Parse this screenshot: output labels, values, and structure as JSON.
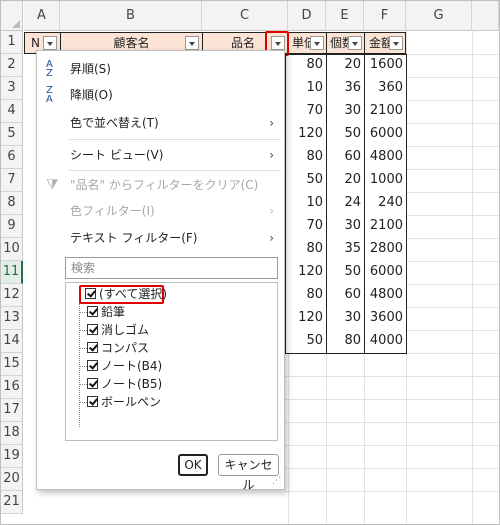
{
  "columns": [
    "A",
    "B",
    "C",
    "D",
    "E",
    "F",
    "G"
  ],
  "rows": [
    "1",
    "2",
    "3",
    "4",
    "5",
    "6",
    "7",
    "8",
    "9",
    "10",
    "11",
    "12",
    "13",
    "14",
    "15",
    "16",
    "17",
    "18",
    "19",
    "20",
    "21"
  ],
  "header_cells": {
    "a": "N",
    "b": "顧客名",
    "c": "品名",
    "d": "単価",
    "e": "個数",
    "f": "金額"
  },
  "data_rows": [
    [
      "80",
      "20",
      "1600"
    ],
    [
      "10",
      "36",
      "360"
    ],
    [
      "70",
      "30",
      "2100"
    ],
    [
      "120",
      "50",
      "6000"
    ],
    [
      "80",
      "60",
      "4800"
    ],
    [
      "50",
      "20",
      "1000"
    ],
    [
      "10",
      "24",
      "240"
    ],
    [
      "70",
      "30",
      "2100"
    ],
    [
      "80",
      "35",
      "2800"
    ],
    [
      "120",
      "50",
      "6000"
    ],
    [
      "80",
      "60",
      "4800"
    ],
    [
      "120",
      "30",
      "3600"
    ],
    [
      "50",
      "80",
      "4000"
    ]
  ],
  "menu": {
    "sort_asc": "昇順(S)",
    "sort_desc": "降順(O)",
    "sort_by_color": "色で並べ替え(T)",
    "sheet_view": "シート ビュー(V)",
    "clear_filter": "\"品名\" からフィルターをクリア(C)",
    "color_filter": "色フィルター(I)",
    "text_filter": "テキスト フィルター(F)",
    "search_placeholder": "検索",
    "items": [
      "(すべて選択)",
      "鉛筆",
      "消しゴム",
      "コンパス",
      "ノート(B4)",
      "ノート(B5)",
      "ボールペン"
    ],
    "ok": "OK",
    "cancel": "キャンセル"
  },
  "colors": {
    "header_fill": "#fbe4d5",
    "highlight": "#e00000",
    "excel_green": "#217346"
  }
}
